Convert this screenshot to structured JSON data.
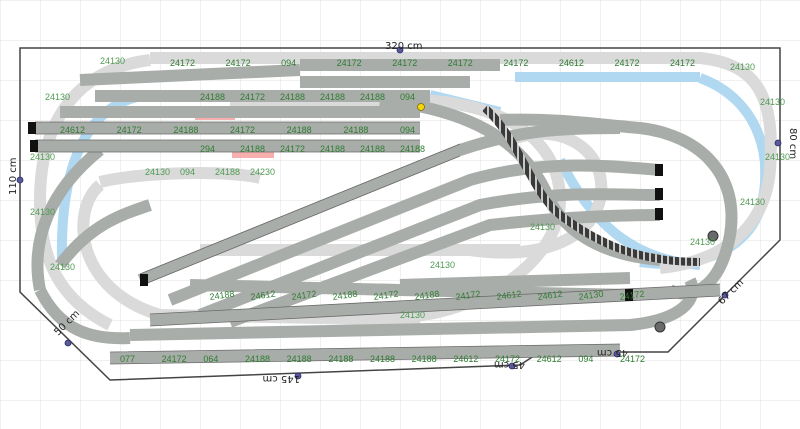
{
  "colors": {
    "background": "#ffffff",
    "grid": "#e2e2e2",
    "board_outline": "#444444",
    "track_fill": "#a9ada9",
    "track_ghost": "#d9dad9",
    "track_edge": "#6a6a6a",
    "piece_label": "#2e7d32",
    "ghost_label": "#4f9a52",
    "highlight_blue": "#a9d4f0",
    "highlight_red": "#f4a0a0",
    "dimension_text": "#222222",
    "dimension_marker": "#5a5a9a",
    "bridge_dark": "#3a3a3a",
    "buffer_stop": "#111111",
    "signal_yellow": "#f2d60a"
  },
  "dimensions": {
    "width_top": "320 cm",
    "depth_left": "110 cm",
    "depth_right": "80 cm",
    "bottom_left": "145 cm",
    "bottom_mid": "45 cm",
    "bottom_right": "45 cm",
    "corner_left": "50 cm",
    "corner_right": "67 cm"
  },
  "piece_labels": {
    "front_row": [
      "077",
      "24172",
      "064",
      "24188",
      "24188",
      "24188",
      "24188",
      "24188",
      "24612",
      "24172",
      "24612",
      "094",
      "24172"
    ],
    "back_row": [
      "24172",
      "24172",
      "094",
      "24172",
      "24172",
      "24172",
      "24172",
      "24612",
      "24172",
      "24172"
    ],
    "yard_row_1": [
      "24188",
      "24172",
      "24188",
      "24188",
      "24188",
      "094"
    ],
    "yard_row_2": [
      "24612",
      "24172",
      "24188",
      "24172",
      "24188",
      "24188",
      "094"
    ],
    "yard_row_3": [
      "294",
      "24188",
      "24172",
      "24188",
      "24188",
      "24188"
    ],
    "curve_labels": [
      "24130",
      "24130",
      "24130",
      "24130",
      "24130",
      "24130",
      "24130",
      "24130",
      "24130",
      "24130",
      "24130",
      "24130",
      "24130"
    ],
    "upper_curve": [
      "24130",
      "094",
      "24188",
      "24230"
    ],
    "misc": [
      "24188",
      "24612",
      "24172",
      "24188",
      "24172",
      "24188",
      "24172",
      "24612",
      "24612",
      "24130",
      "24172"
    ]
  }
}
